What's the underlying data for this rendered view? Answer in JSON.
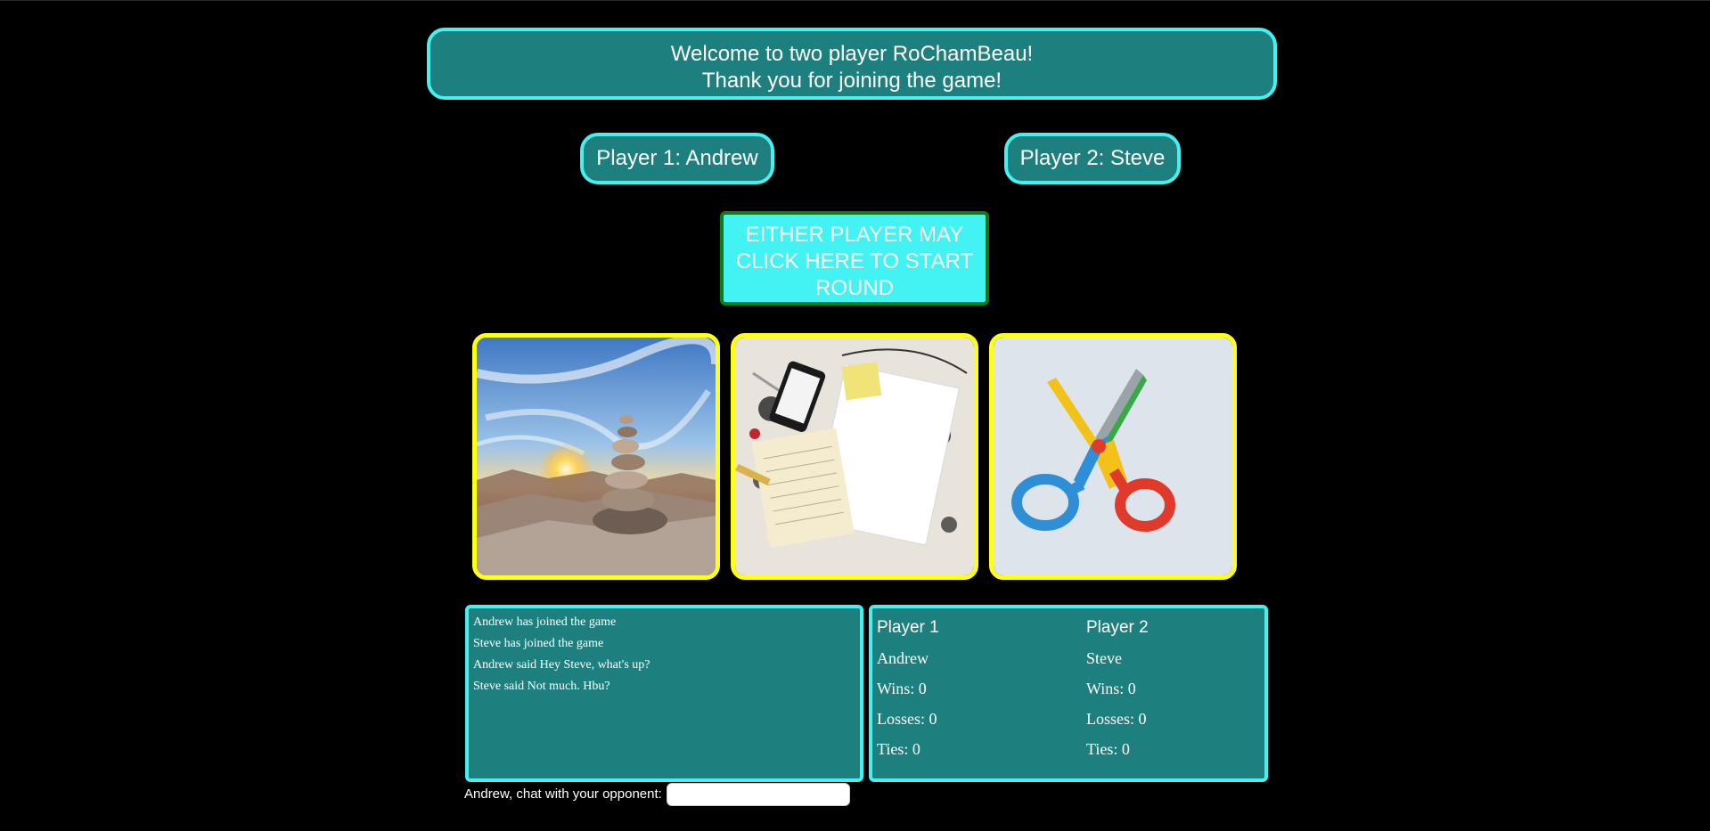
{
  "header": {
    "line1": "Welcome to two player RoChamBeau!",
    "line2": "Thank you for joining the game!"
  },
  "players": {
    "p1_label": "Player 1: Andrew",
    "p2_label": "Player 2: Steve"
  },
  "start_button": {
    "label": "EITHER PLAYER MAY CLICK HERE TO START ROUND"
  },
  "choices": [
    {
      "name": "rock",
      "icon": "rock-cairn-image"
    },
    {
      "name": "paper",
      "icon": "paper-sheets-image"
    },
    {
      "name": "scissors",
      "icon": "scissors-image"
    }
  ],
  "chat": {
    "messages": [
      "Andrew has joined the game",
      "Steve has joined the game",
      "Andrew said Hey Steve, what's up?",
      "Steve said Not much. Hbu?"
    ],
    "input_label": "Andrew, chat with your opponent:",
    "input_value": "",
    "input_placeholder": ""
  },
  "stats": {
    "player1": {
      "heading": "Player 1",
      "name": "Andrew",
      "wins": "Wins: 0",
      "losses": "Losses: 0",
      "ties": "Ties: 0"
    },
    "player2": {
      "heading": "Player 2",
      "name": "Steve",
      "wins": "Wins: 0",
      "losses": "Losses: 0",
      "ties": "Ties: 0"
    }
  },
  "colors": {
    "background": "#000000",
    "panel": "#1e807e",
    "panel_border": "#46f0ee",
    "start_button": "#43f2f2",
    "start_button_border": "#0e7a1c",
    "choice_border": "#ffff19"
  }
}
